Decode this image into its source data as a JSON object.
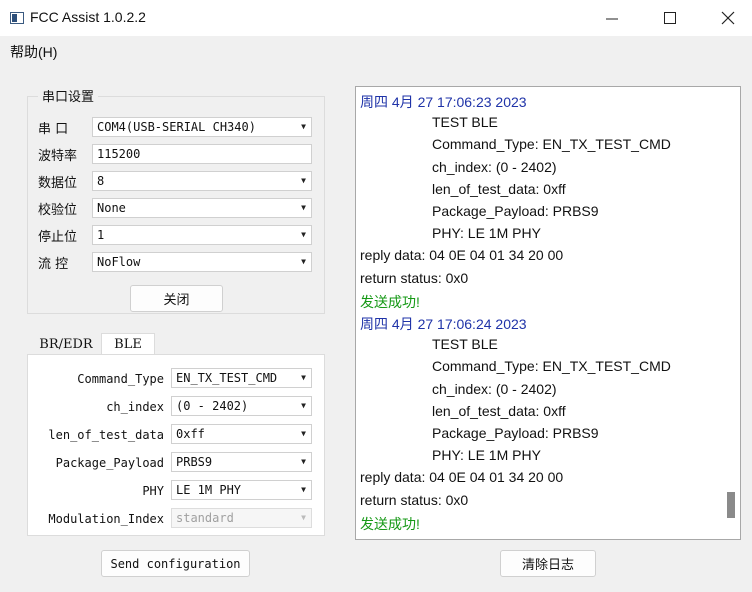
{
  "window": {
    "title": "FCC Assist 1.0.2.2"
  },
  "menu": {
    "help": "帮助(H)"
  },
  "serial": {
    "group_title": "串口设置",
    "rows": [
      {
        "label": "串  口",
        "value": "COM4(USB-SERIAL CH340)",
        "type": "combo"
      },
      {
        "label": "波特率",
        "value": "115200",
        "type": "input"
      },
      {
        "label": "数据位",
        "value": "8",
        "type": "combo"
      },
      {
        "label": "校验位",
        "value": "None",
        "type": "combo"
      },
      {
        "label": "停止位",
        "value": "1",
        "type": "combo"
      },
      {
        "label": "流  控",
        "value": "NoFlow",
        "type": "combo"
      }
    ],
    "close_button": "关闭"
  },
  "tabs": [
    {
      "label": "BR/EDR",
      "active": false
    },
    {
      "label": "BLE",
      "active": true
    }
  ],
  "ble": {
    "fields": [
      {
        "label": "Command_Type",
        "value": "EN_TX_TEST_CMD",
        "disabled": false
      },
      {
        "label": "ch_index",
        "value": "(0 - 2402)",
        "disabled": false
      },
      {
        "label": "len_of_test_data",
        "value": "0xff",
        "disabled": false
      },
      {
        "label": "Package_Payload",
        "value": "PRBS9",
        "disabled": false
      },
      {
        "label": "PHY",
        "value": "LE 1M PHY",
        "disabled": false
      },
      {
        "label": "Modulation_Index",
        "value": "standard",
        "disabled": true
      }
    ]
  },
  "send_button": "Send configuration",
  "clear_log_button": "清除日志",
  "log": {
    "lines": [
      {
        "text": "周四 4月 27 17:06:23 2023",
        "kind": "ts"
      },
      {
        "text": "TEST BLE",
        "kind": "ind"
      },
      {
        "text": "Command_Type: EN_TX_TEST_CMD",
        "kind": "ind"
      },
      {
        "text": "ch_index: (0 - 2402)",
        "kind": "ind"
      },
      {
        "text": "len_of_test_data: 0xff",
        "kind": "ind"
      },
      {
        "text": "Package_Payload: PRBS9",
        "kind": "ind"
      },
      {
        "text": "PHY: LE 1M PHY",
        "kind": "ind"
      },
      {
        "text": "reply data: 04 0E 04 01 34 20 00",
        "kind": "plain"
      },
      {
        "text": "return status: 0x0",
        "kind": "plain"
      },
      {
        "text": "发送成功!",
        "kind": "ok"
      },
      {
        "text": "周四 4月 27 17:06:24 2023",
        "kind": "ts"
      },
      {
        "text": "TEST BLE",
        "kind": "ind"
      },
      {
        "text": "Command_Type: EN_TX_TEST_CMD",
        "kind": "ind"
      },
      {
        "text": "ch_index: (0 - 2402)",
        "kind": "ind"
      },
      {
        "text": "len_of_test_data: 0xff",
        "kind": "ind"
      },
      {
        "text": "Package_Payload: PRBS9",
        "kind": "ind"
      },
      {
        "text": "PHY: LE 1M PHY",
        "kind": "ind"
      },
      {
        "text": "reply data: 04 0E 04 01 34 20 00",
        "kind": "plain"
      },
      {
        "text": "return status: 0x0",
        "kind": "plain"
      },
      {
        "text": "发送成功!",
        "kind": "ok"
      }
    ]
  },
  "colors": {
    "timestamp": "#1f33a8",
    "success": "#169916"
  }
}
